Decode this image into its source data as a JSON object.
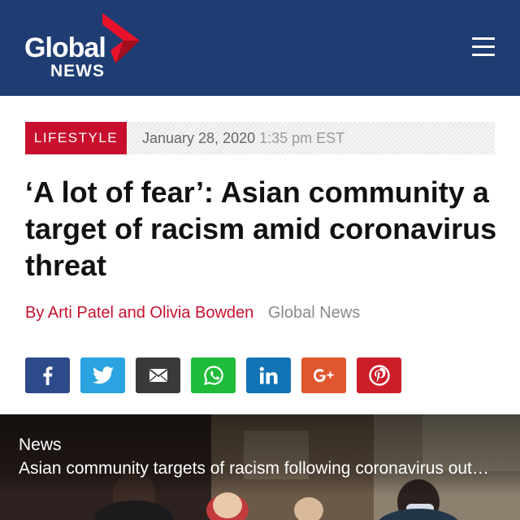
{
  "header": {
    "logo_line1": "Global",
    "logo_line2": "NEWS",
    "background_color": "#1f3c73",
    "menu_icon": "hamburger-menu-icon"
  },
  "article": {
    "category": "LIFESTYLE",
    "category_color": "#c8102e",
    "date": "January 28, 2020",
    "time": "1:35 pm EST",
    "headline": "‘A lot of fear’: Asian community a target of racism amid coronavirus threat",
    "byline": {
      "authors": "By Arti Patel and Olivia Bowden",
      "outlet": "Global News"
    }
  },
  "share": [
    {
      "name": "facebook",
      "icon": "facebook-icon",
      "color": "#2d4a8a"
    },
    {
      "name": "twitter",
      "icon": "twitter-icon",
      "color": "#2aa3e0"
    },
    {
      "name": "email",
      "icon": "email-icon",
      "color": "#3a3a3a"
    },
    {
      "name": "whatsapp",
      "icon": "whatsapp-icon",
      "color": "#1fbc3a"
    },
    {
      "name": "linkedin",
      "icon": "linkedin-icon",
      "color": "#1273b5"
    },
    {
      "name": "google-plus",
      "icon": "google-plus-icon",
      "color": "#e0562e"
    },
    {
      "name": "pinterest",
      "icon": "pinterest-icon",
      "color": "#cc1e28"
    }
  ],
  "media": {
    "tag": "News",
    "caption": "Asian community targets of racism following coronavirus outbreak"
  }
}
